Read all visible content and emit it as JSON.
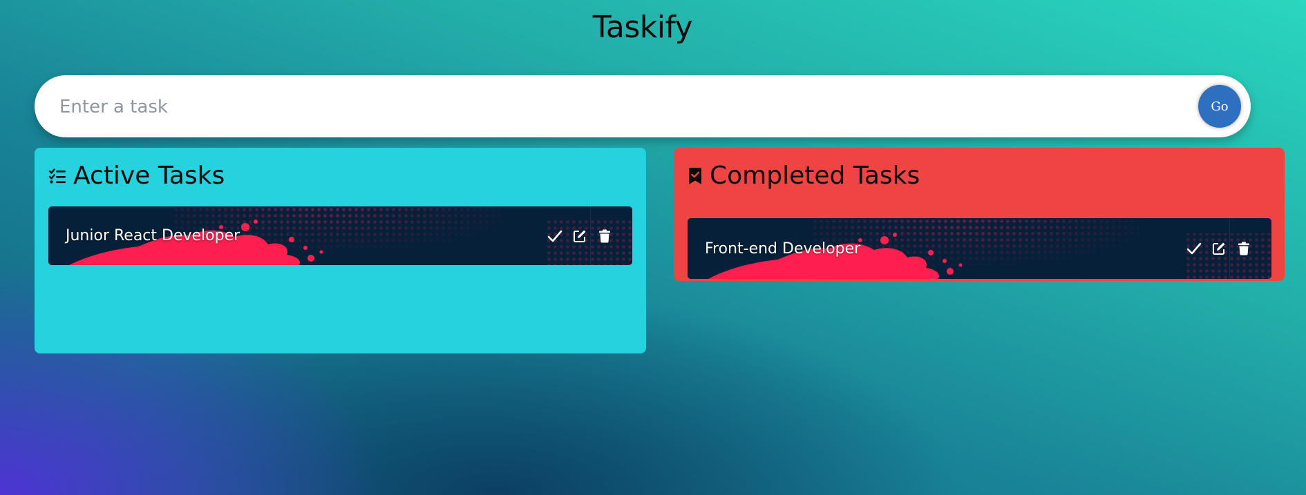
{
  "app": {
    "title": "Taskify"
  },
  "input": {
    "placeholder": "Enter a task",
    "value": "",
    "submit_label": "Go"
  },
  "panels": {
    "active": {
      "heading": "Active Tasks",
      "icon": "list-check-icon",
      "background": "#25d2de",
      "tasks": [
        {
          "text": "Junior React Developer"
        }
      ]
    },
    "completed": {
      "heading": "Completed Tasks",
      "icon": "bookmark-check-icon",
      "background": "#ef4444",
      "tasks": [
        {
          "text": "Front-end Developer"
        }
      ]
    }
  },
  "task_actions": [
    "check-icon",
    "edit-icon",
    "trash-icon"
  ],
  "colors": {
    "go_button": "#2f6fbf",
    "card_background": "#062039",
    "splash_accent": "#ff1f4f"
  }
}
